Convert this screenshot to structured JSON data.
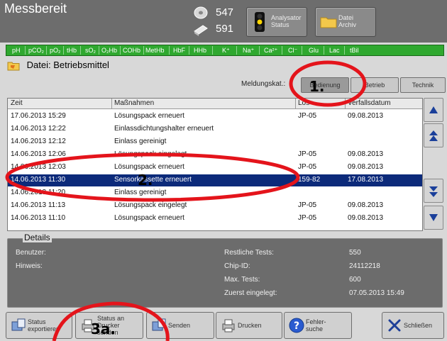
{
  "app": {
    "title": "Messbereit"
  },
  "counters": [
    {
      "value": "547",
      "icon": "disc-icon"
    },
    {
      "value": "591",
      "icon": "cartridge-icon"
    }
  ],
  "topbuttons": {
    "analyzer": {
      "line1": "Analysator",
      "line2": "Status"
    },
    "file": {
      "line1": "Datei",
      "line2": "Archiv"
    }
  },
  "params": [
    "pH",
    "pCO₂",
    "pO₂",
    "tHb",
    "sO₂",
    "O₂Hb",
    "COHb",
    "MetHb",
    "HbF",
    "HHb",
    "K⁺",
    "Na⁺",
    "Ca²⁺",
    "Cl⁻",
    "Glu",
    "Lac",
    "tBil"
  ],
  "file_header": "Datei: Betriebsmittel",
  "category": {
    "label": "Meldungskat.:",
    "buttons": [
      "Bedienung",
      "Betrieb",
      "Technik"
    ],
    "selected": 0
  },
  "table": {
    "headers": [
      "Zeit",
      "Maßnahmen",
      "Los",
      "Verfallsdatum"
    ],
    "rows": [
      [
        "17.06.2013 15:29",
        "Lösungspack erneuert",
        "JP-05",
        "09.08.2013"
      ],
      [
        "14.06.2013 12:22",
        "Einlassdichtungshalter erneuert",
        "",
        ""
      ],
      [
        "14.06.2013 12:12",
        "Einlass gereinigt",
        "",
        ""
      ],
      [
        "14.06.2013 12:06",
        "Lösungspack eingelegt",
        "JP-05",
        "09.08.2013"
      ],
      [
        "14.06.2013 12:03",
        "Lösungspack erneuert",
        "JP-05",
        "09.08.2013"
      ],
      [
        "14.06.2013 11:30",
        "Sensorkassette erneuert",
        "159-82",
        "17.08.2013"
      ],
      [
        "14.06.2013 11:20",
        "Einlass gereinigt",
        "",
        ""
      ],
      [
        "14.06.2013 11:13",
        "Lösungspack eingelegt",
        "JP-05",
        "09.08.2013"
      ],
      [
        "14.06.2013 11:10",
        "Lösungspack erneuert",
        "JP-05",
        "09.08.2013"
      ]
    ],
    "selected_row": 5
  },
  "details": {
    "title": "Details",
    "user_label": "Benutzer:",
    "note_label": "Hinweis:",
    "remaining_label": "Restliche Tests:",
    "remaining_value": "550",
    "chip_label": "Chip-ID:",
    "chip_value": "24112218",
    "max_label": "Max. Tests:",
    "max_value": "600",
    "first_label": "Zuerst eingelegt:",
    "first_value": "07.05.2013 15:49"
  },
  "bottom": {
    "status_export": {
      "line1": "Status",
      "line2": "exportieren"
    },
    "status_send": {
      "line1": "Status an",
      "line2": "Drucker",
      "line3": "senden"
    },
    "send": "Senden",
    "print": "Drucken",
    "error_search": {
      "line1": "Fehler-",
      "line2": "suche"
    },
    "close": "Schließen"
  },
  "annotations": [
    "1.",
    "2.",
    "3a."
  ],
  "colors": {
    "highlight": "#0c2a7a",
    "param_strip": "#2fa82f",
    "annotation": "#e4141b"
  }
}
